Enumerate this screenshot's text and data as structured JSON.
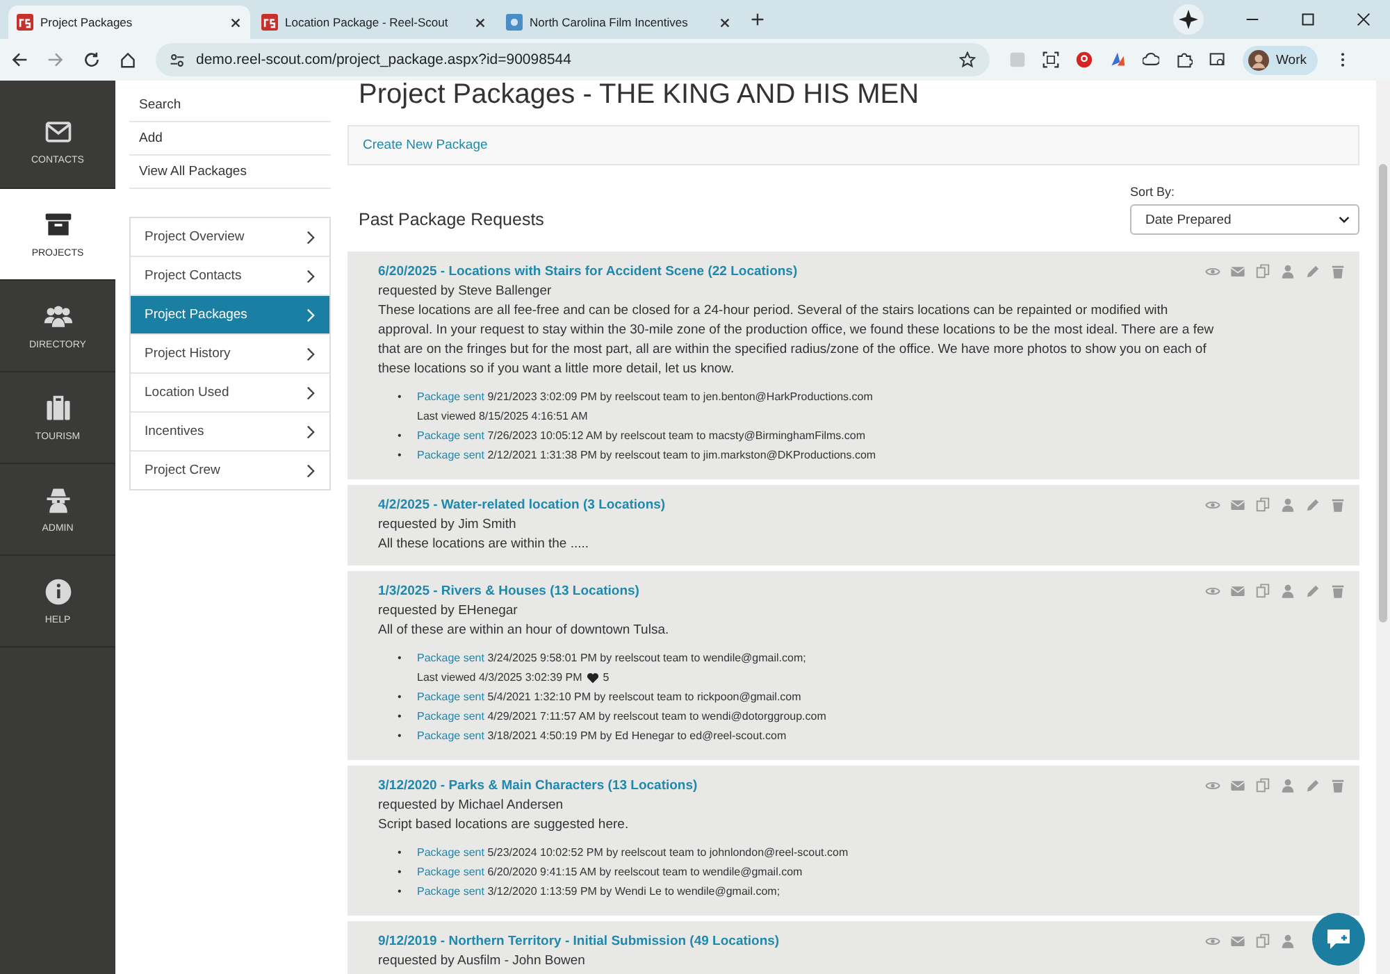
{
  "browser": {
    "tabs": [
      {
        "title": "Project Packages",
        "selected": true
      },
      {
        "title": "Location Package - Reel-Scout",
        "selected": false
      },
      {
        "title": "North Carolina Film Incentives",
        "selected": false
      }
    ],
    "url": "demo.reel-scout.com/project_package.aspx?id=90098544",
    "profile": "Work"
  },
  "rail": [
    {
      "label": "CONTACTS",
      "selected": false
    },
    {
      "label": "PROJECTS",
      "selected": true
    },
    {
      "label": "DIRECTORY",
      "selected": false
    },
    {
      "label": "TOURISM",
      "selected": false
    },
    {
      "label": "ADMIN",
      "selected": false
    },
    {
      "label": "HELP",
      "selected": false
    }
  ],
  "actions": [
    "Search",
    "Add",
    "View All Packages"
  ],
  "project_nav": [
    {
      "label": "Project Overview",
      "selected": false
    },
    {
      "label": "Project Contacts",
      "selected": false
    },
    {
      "label": "Project Packages",
      "selected": true
    },
    {
      "label": "Project History",
      "selected": false
    },
    {
      "label": "Location Used",
      "selected": false
    },
    {
      "label": "Incentives",
      "selected": false
    },
    {
      "label": "Project Crew",
      "selected": false
    }
  ],
  "heading": "Project Packages - THE KING AND HIS MEN",
  "create_link": "Create New Package",
  "section_title": "Past Package Requests",
  "sort": {
    "label": "Sort By:",
    "value": "Date Prepared"
  },
  "packages": [
    {
      "title": "6/20/2025 - Locations with Stairs for Accident Scene (22 Locations)",
      "requested_by": "requested by Steve Ballenger",
      "description": "These locations are all fee-free and can be closed for a 24-hour period. Several of the stairs locations can be repainted or modified with approval. In your request to stay within the 30-mile zone of the production office, we found these locations to be the most ideal. There are a few that are on the fringes but for the most part, all are within the specified radius/zone of the office. We have more photos to show you on each of these locations so if you want a little more detail, let us know.",
      "sends": [
        {
          "bullet": "•",
          "link": "Package sent",
          "detail": "9/21/2023 3:02:09 PM by reelscout team to jen.benton@HarkProductions.com",
          "last_viewed": "Last viewed 8/15/2025 4:16:51 AM"
        },
        {
          "bullet": "•",
          "link": "Package sent",
          "detail": "7/26/2023 10:05:12 AM by reelscout team to macsty@BirminghamFilms.com"
        },
        {
          "bullet": "•",
          "link": "Package sent",
          "detail": "2/12/2021 1:31:38 PM by reelscout team to jim.markston@DKProductions.com"
        }
      ]
    },
    {
      "title": "4/2/2025 - Water-related location (3 Locations)",
      "requested_by": "requested by Jim Smith",
      "description": "All these locations are within the ....."
    },
    {
      "title": "1/3/2025 - Rivers & Houses (13 Locations)",
      "requested_by": "requested by EHenegar",
      "description": "All of these are within an hour of downtown Tulsa.",
      "sends": [
        {
          "bullet": "•",
          "link": "Package sent",
          "detail": "3/24/2025 9:58:01 PM by reelscout team to wendile@gmail.com;",
          "last_viewed": "Last viewed 4/3/2025 3:02:39 PM",
          "likes": "5"
        },
        {
          "bullet": "•",
          "link": "Package sent",
          "detail": "5/4/2021 1:32:10 PM by reelscout team to rickpoon@gmail.com"
        },
        {
          "bullet": "•",
          "link": "Package sent",
          "detail": "4/29/2021 7:11:57 AM by reelscout team to wendi@dotorggroup.com"
        },
        {
          "bullet": "•",
          "link": "Package sent",
          "detail": "3/18/2021 4:50:19 PM by Ed Henegar to ed@reel-scout.com"
        }
      ]
    },
    {
      "title": "3/12/2020 - Parks & Main Characters (13 Locations)",
      "requested_by": "requested by Michael Andersen",
      "description": "Script based locations are suggested here.",
      "sends": [
        {
          "bullet": "•",
          "link": "Package sent",
          "detail": "5/23/2024 10:02:52 PM by reelscout team to johnlondon@reel-scout.com"
        },
        {
          "bullet": "•",
          "link": "Package sent",
          "detail": "6/20/2020 9:41:15 AM by reelscout team to wendile@gmail.com"
        },
        {
          "bullet": "•",
          "link": "Package sent",
          "detail": "3/12/2020 1:13:59 PM by Wendi Le to wendile@gmail.com;"
        }
      ]
    },
    {
      "title": "9/12/2019 - Northern Territory - Initial Submission (49 Locations)",
      "requested_by": "requested by Ausfilm - John Bowen"
    }
  ]
}
